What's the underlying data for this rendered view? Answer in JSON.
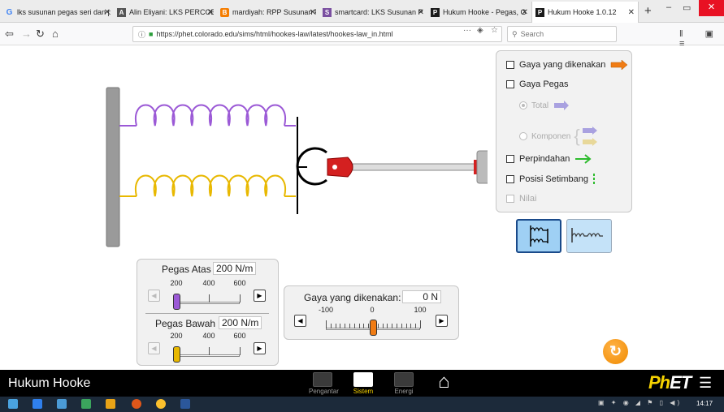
{
  "browser": {
    "tabs": [
      {
        "title": "lks susunan pegas seri dan p",
        "fav": "G",
        "fav_color": "#4285f4"
      },
      {
        "title": "Alin Eliyani: LKS PERCOBAA",
        "fav": "A",
        "fav_color": "#555555"
      },
      {
        "title": "mardiyah: RPP Susunan Pe",
        "fav": "B",
        "fav_color": "#f57d00"
      },
      {
        "title": "smartcard: LKS Susunan P",
        "fav": "S",
        "fav_color": "#7a4fa0"
      },
      {
        "title": "Hukum Hooke - Pegas, G",
        "fav": "P",
        "fav_color": "#1a1a1a"
      },
      {
        "title": "Hukum Hooke 1.0.12",
        "fav": "P",
        "fav_color": "#1a1a1a"
      }
    ],
    "url": "https://phet.colorado.edu/sims/html/hookes-law/latest/hookes-law_in.html",
    "search_placeholder": "Search",
    "url_menu_icon": "···"
  },
  "checkboxes": {
    "applied_force": "Gaya yang dikenakan",
    "spring_force": "Gaya Pegas",
    "total": "Total",
    "components": "Komponen",
    "displacement": "Perpindahan",
    "equilibrium": "Posisi Setimbang",
    "values": "Nilai"
  },
  "top_spring": {
    "label": "Pegas Atas",
    "value": "200 N/m",
    "ticks": [
      "200",
      "400",
      "600"
    ],
    "value_fraction": 0.0
  },
  "bottom_spring": {
    "label": "Pegas Bawah",
    "value": "200 N/m",
    "ticks": [
      "200",
      "400",
      "600"
    ],
    "value_fraction": 0.0
  },
  "applied_force": {
    "label": "Gaya yang dikenakan:",
    "value": "0 N",
    "ticks": [
      "-100",
      "0",
      "100"
    ],
    "value_fraction": 0.5
  },
  "footer": {
    "title": "Hukum Hooke",
    "screens": [
      "Pengantar",
      "Sistem",
      "Energi"
    ],
    "active_screen": "Sistem",
    "brand_ph": "Ph",
    "brand_et": "ET"
  },
  "taskbar": {
    "clock": "14:17"
  },
  "colors": {
    "top_spring": "#9b59d6",
    "bottom_spring": "#e8b800",
    "applied_force_arrow": "#f07c14",
    "total_arrow": "#a9a1e0",
    "component_arrow": "#e8d89a",
    "displacement_arrow": "#2dbb2d",
    "equilibrium_line": "#2dbb2d",
    "slider_top_thumb": "#9b59d6",
    "slider_bottom_thumb": "#e8b800",
    "slider_force_thumb": "#f07c14"
  }
}
